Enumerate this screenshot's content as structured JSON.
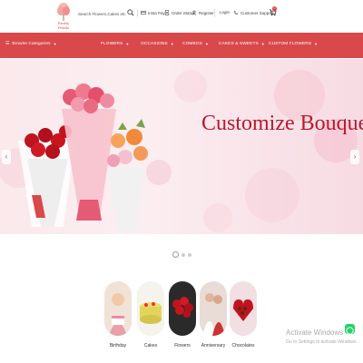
{
  "header": {
    "logo_text": "Pretty Petals",
    "search_placeholder": "Search Flowers,Cakes etc",
    "links": {
      "insta_pay": "Insta Pay",
      "order_status": "Order Status",
      "register": "Register",
      "login": "Login",
      "customer_support": "Customer Support"
    },
    "cart_count": "0"
  },
  "nav": {
    "browse": "Browse Categories",
    "items": [
      "FLOWERS",
      "OCCASIONS",
      "COMBOS",
      "CAKES & SWEETS",
      "CUSTOM FLOWERS"
    ]
  },
  "hero": {
    "title": "Customize Bouquet",
    "prev": "‹",
    "next": "›"
  },
  "categories": [
    {
      "label": "Birthday"
    },
    {
      "label": "Cakes"
    },
    {
      "label": "Flowers"
    },
    {
      "label": "Anniversary"
    },
    {
      "label": "Chocolates"
    }
  ],
  "watermark": {
    "line1": "Activate Windows",
    "line2": "Go to Settings to activate Windows."
  },
  "colors": {
    "brand": "#d9484a",
    "hero_text": "#b8192f"
  }
}
